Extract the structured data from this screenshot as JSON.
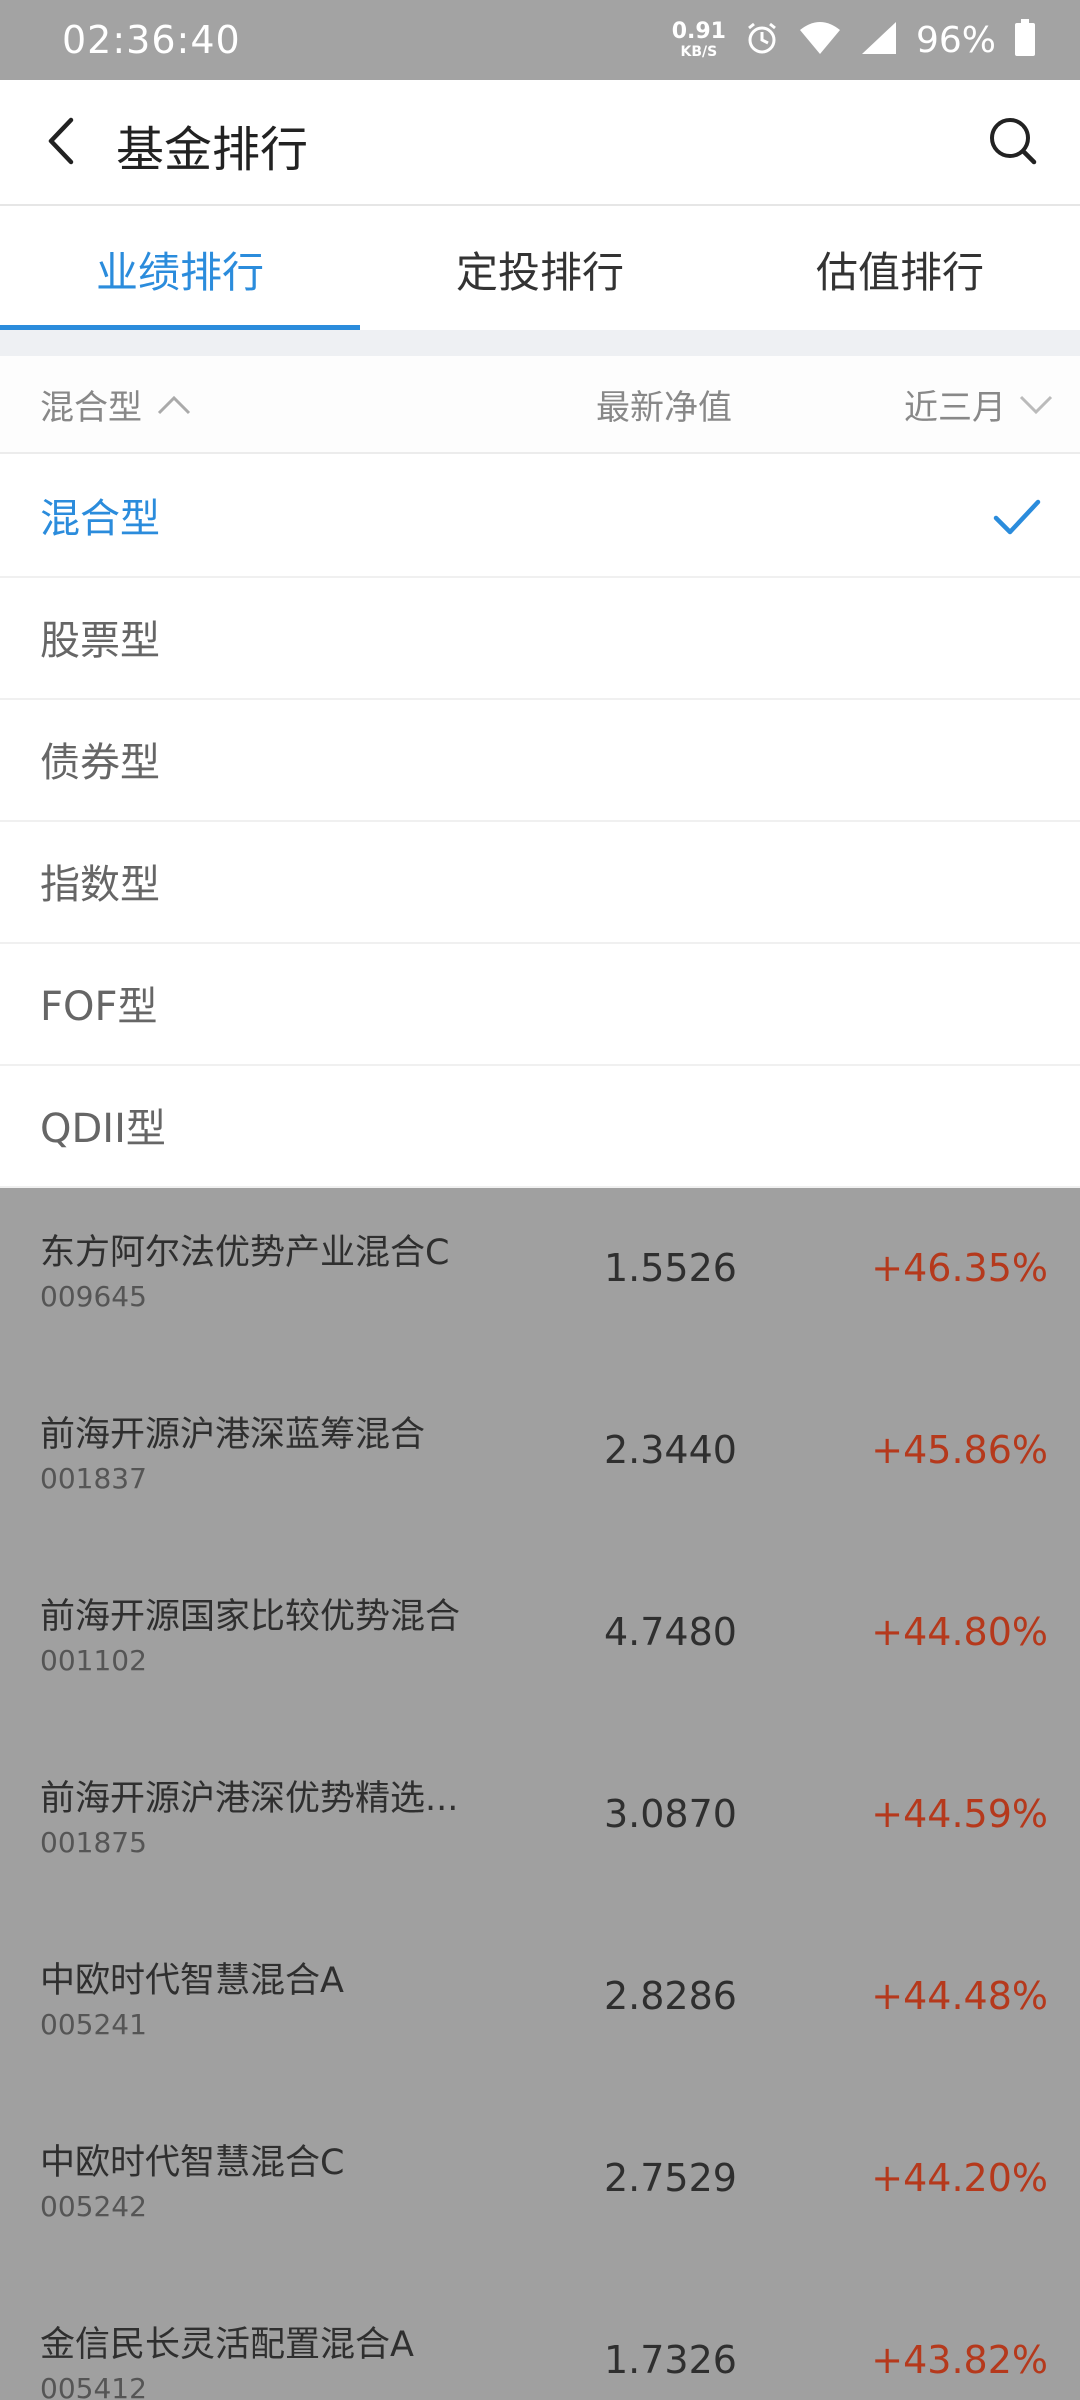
{
  "status_bar": {
    "time": "02:36:40",
    "net_speed_value": "0.91",
    "net_speed_unit": "KB/S",
    "battery": "96%"
  },
  "header": {
    "title": "基金排行"
  },
  "tabs": [
    {
      "label": "业绩排行",
      "active": true
    },
    {
      "label": "定投排行",
      "active": false
    },
    {
      "label": "估值排行",
      "active": false
    }
  ],
  "columns": {
    "type": "混合型",
    "nav": "最新净值",
    "period": "近三月"
  },
  "dropdown": {
    "items": [
      "混合型",
      "股票型",
      "债券型",
      "指数型",
      "FOF型",
      "QDII型"
    ],
    "selected": "混合型"
  },
  "funds": [
    {
      "name": "东方阿尔法优势产业混合C",
      "code": "009645",
      "nav": "1.5526",
      "change": "+46.35%"
    },
    {
      "name": "前海开源沪港深蓝筹混合",
      "code": "001837",
      "nav": "2.3440",
      "change": "+45.86%"
    },
    {
      "name": "前海开源国家比较优势混合",
      "code": "001102",
      "nav": "4.7480",
      "change": "+44.80%"
    },
    {
      "name": "前海开源沪港深优势精选...",
      "code": "001875",
      "nav": "3.0870",
      "change": "+44.59%"
    },
    {
      "name": "中欧时代智慧混合A",
      "code": "005241",
      "nav": "2.8286",
      "change": "+44.48%"
    },
    {
      "name": "中欧时代智慧混合C",
      "code": "005242",
      "nav": "2.7529",
      "change": "+44.20%"
    },
    {
      "name": "金信民长灵活配置混合A",
      "code": "005412",
      "nav": "1.7326",
      "change": "+43.82%"
    }
  ],
  "colors": {
    "accent": "#2b8cdc",
    "positive_change": "#b5391c",
    "overlay": "#a0a0a0"
  }
}
